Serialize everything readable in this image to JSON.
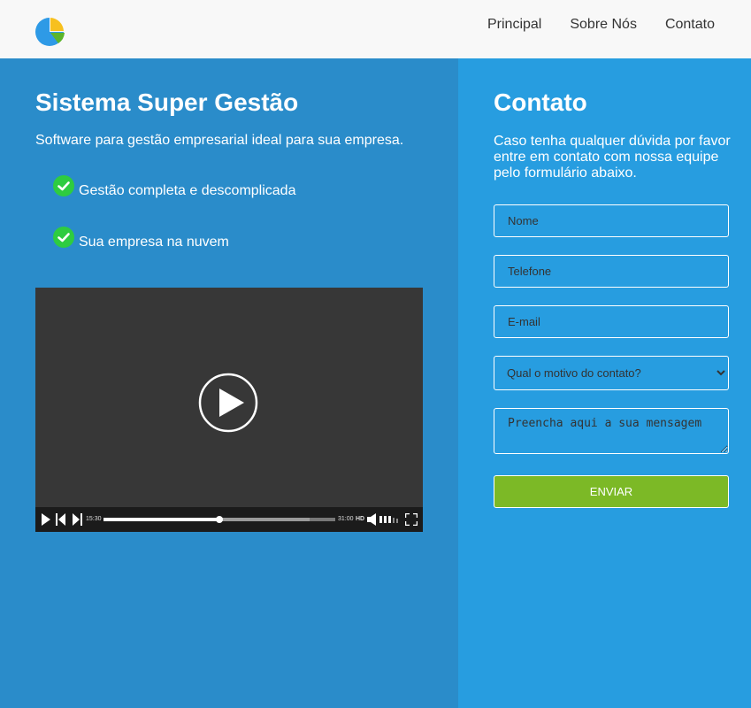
{
  "header": {
    "logo": "pie-chart-logo",
    "nav": [
      {
        "label": "Principal"
      },
      {
        "label": "Sobre Nós"
      },
      {
        "label": "Contato"
      }
    ]
  },
  "hero": {
    "title": "Sistema Super Gestão",
    "tagline": "Software para gestão empresarial ideal para sua empresa.",
    "features": [
      {
        "icon": "check-circle-icon",
        "text": "Gestão completa e descomplicada"
      },
      {
        "icon": "check-circle-icon",
        "text": "Sua empresa na nuvem"
      }
    ]
  },
  "video": {
    "current_time": "15:30",
    "duration": "31:00",
    "quality": "HD",
    "progress_fraction": 0.5,
    "buffered_fraction": 0.89
  },
  "contact": {
    "title": "Contato",
    "intro": "Caso tenha qualquer dúvida por favor entre em contato com nossa equipe pelo formulário abaixo.",
    "name_placeholder": "Nome",
    "phone_placeholder": "Telefone",
    "email_placeholder": "E-mail",
    "reason_selected": "Qual o motivo do contato?",
    "message_placeholder": "Preencha aqui a sua mensagem",
    "submit_label": "ENVIAR"
  },
  "colors": {
    "header_bg": "#f8f8f8",
    "left_bg": "#2a8cca",
    "right_bg": "#279de0",
    "submit_bg": "#7cb926",
    "check_green": "#2ecc40"
  }
}
